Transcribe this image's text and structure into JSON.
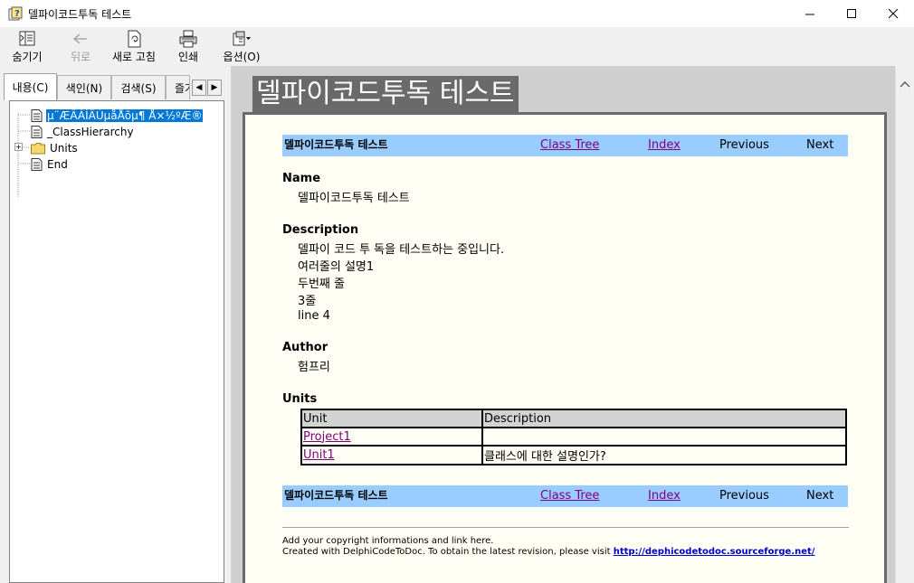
{
  "window": {
    "title": "델파이코드투독 테스트",
    "app_icon": "help-question-icon"
  },
  "toolbar": {
    "hide_label": "숨기기",
    "back_label": "뒤로",
    "refresh_label": "새로 고침",
    "print_label": "인쇄",
    "options_label": "옵션(O)"
  },
  "tabs": {
    "contents": "내용(C)",
    "index": "색인(N)",
    "search": "검색(S)",
    "favorites": "즐겨"
  },
  "tree": {
    "items": [
      {
        "label": "µ¨ÆÄÀÌÄÚµåÅõµ¶ Å×½ºÆ®",
        "icon": "document-icon",
        "selected": true
      },
      {
        "label": "_ClassHierarchy",
        "icon": "document-icon",
        "selected": false
      },
      {
        "label": "Units",
        "icon": "folder-icon",
        "selected": false
      },
      {
        "label": "End",
        "icon": "document-icon",
        "selected": false
      }
    ]
  },
  "page": {
    "big_title": "델파이코드투독 테스트",
    "nav": {
      "title": "델파이코드투독 테스트",
      "class_tree": "Class Tree",
      "index": "Index",
      "previous": "Previous",
      "next": "Next"
    },
    "name_head": "Name",
    "name_value": "델파이코드투독 테스트",
    "description_head": "Description",
    "description_lines": [
      "델파이 코드 투 독을 테스트하는 중입니다.",
      "여러줄의 설명1",
      "두번째 줄",
      "3줄",
      "line 4"
    ],
    "author_head": "Author",
    "author_value": "험프리",
    "units_head": "Units",
    "units_table": {
      "headers": [
        "Unit",
        "Description"
      ],
      "rows": [
        [
          "Project1",
          ""
        ],
        [
          "Unit1",
          "클래스에 대한 설명인가?"
        ]
      ]
    },
    "footer": {
      "line1": "Add your copyright informations and link here.",
      "line2_prefix": "Created with DelphiCodeToDoc. To obtain the latest revision, please visit ",
      "link": "http://dephicodetodoc.sourceforge.net/"
    }
  },
  "colors": {
    "nav_bg": "#99ccff",
    "page_bg": "#fffff6",
    "title_bg": "#6a6a6a",
    "visited_link": "#800080",
    "selection": "#0078d7"
  }
}
